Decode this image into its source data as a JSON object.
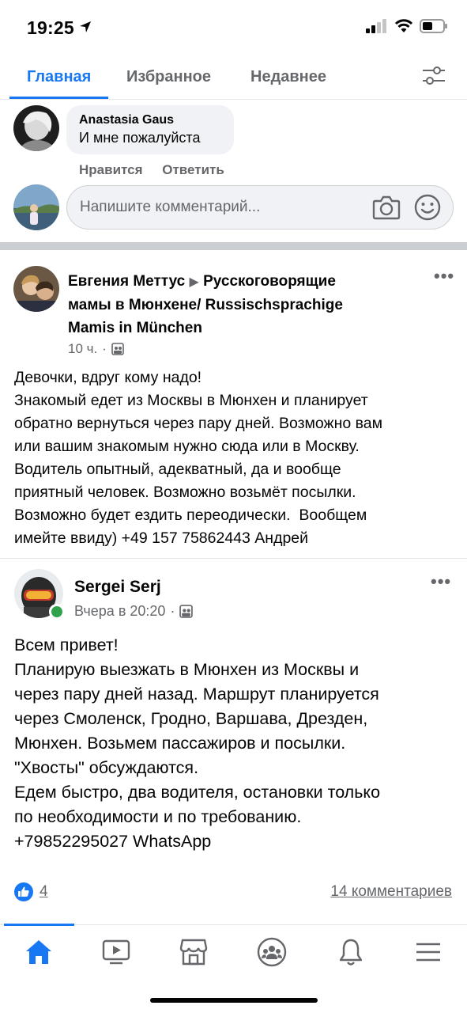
{
  "status_bar": {
    "time": "19:25"
  },
  "tabs": [
    {
      "label": "Главная",
      "active": true
    },
    {
      "label": "Избранное",
      "active": false
    },
    {
      "label": "Недавнее",
      "active": false
    }
  ],
  "comment": {
    "author": "Anastasia Gaus",
    "text": "И мне пожалуйста",
    "like_label": "Нравится",
    "reply_label": "Ответить"
  },
  "composer": {
    "placeholder": "Напишите комментарий..."
  },
  "posts": [
    {
      "author": "Евгения Меттус",
      "group": "Русскоговорящие",
      "header_line2": "мамы в Мюнхене/ Russischsprachige",
      "header_line3": "Mamis in München",
      "time": "10 ч.",
      "body": "Девочки, вдруг кому надо!\nЗнакомый едет из Москвы в Мюнхен и планирует\nобратно вернуться через пару дней. Возможно вам\nили вашим знакомым нужно сюда или в Москву.\nВодитель опытный, адекватный, да и вообще\nприятный человек. Возможно возьмёт посылки.\nВозможно будет ездить переодически.  Вообщем\nимейте ввиду) +49 157 75862443 Андрей"
    },
    {
      "author": "Sergei Serj",
      "time": "Вчера в 20:20",
      "body": "Всем привет!\nПланирую выезжать в Мюнхен из Москвы и\nчерез пару дней назад. Маршрут планируется\nчерез Смоленск, Гродно, Варшава, Дрезден,\nМюнхен. Возьмем пассажиров и посылки.\n\"Хвосты\" обсуждаются.\nЕдем быстро, два водителя, остановки только\nпо необходимости и по требованию.\n+79852295027 WhatsApp",
      "reactions": "4",
      "comments": "14 комментариев"
    }
  ],
  "colors": {
    "accent": "#1877f2",
    "secondary_text": "#65676b",
    "online": "#31a24c"
  }
}
